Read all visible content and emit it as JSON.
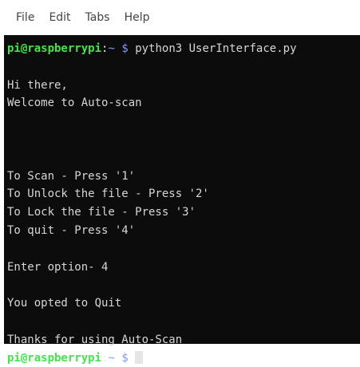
{
  "menu": {
    "file": "File",
    "edit": "Edit",
    "tabs": "Tabs",
    "help": "Help"
  },
  "prompt": {
    "user_host": "pi@raspberrypi",
    "colon": ":",
    "path": "~",
    "dollar": "$"
  },
  "command": "python3 UserInterface.py",
  "output": {
    "greeting": "Hi there,",
    "welcome": "Welcome to Auto-scan",
    "option_1": "To Scan - Press '1'",
    "option_2": "To Unlock the file - Press '2'",
    "option_3": "To Lock the file - Press '3'",
    "option_4": "To quit - Press '4'",
    "enter_option": "Enter option- 4",
    "opted": "You opted to Quit",
    "thanks": "Thanks for using Auto-Scan"
  },
  "colors": {
    "terminal_bg": "#0c0c0c",
    "text": "#d6d6d6",
    "prompt_user": "#43e54a",
    "prompt_path": "#7a9cff"
  }
}
